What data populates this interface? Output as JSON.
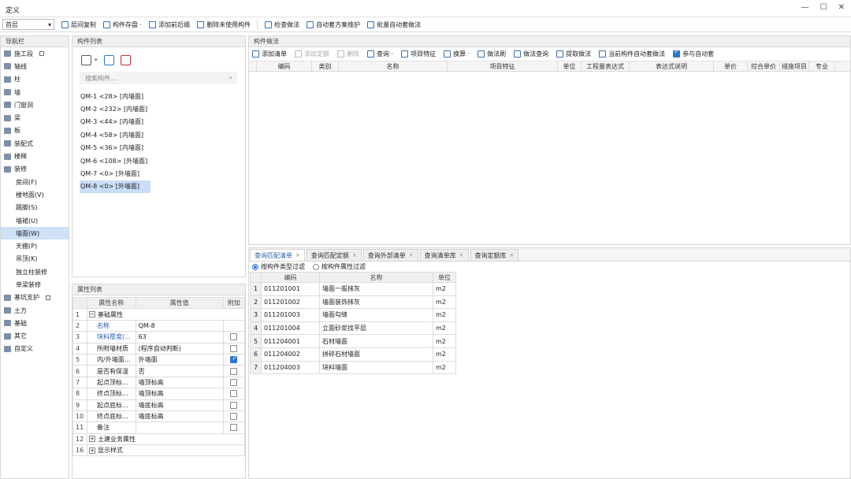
{
  "window": {
    "title": "定义",
    "controls": [
      "—",
      "☐",
      "✕"
    ]
  },
  "toolbar": {
    "floor": "首层",
    "buttons": [
      "层间复制",
      "构件存盘 ·",
      "添加前后缀",
      "删除未使用构件",
      "检查做法",
      "自动套方案维护",
      "批量自动套做法"
    ]
  },
  "nav": {
    "title": "导航栏",
    "items": [
      {
        "label": "施工段",
        "lock": true,
        "sub": false,
        "active": false
      },
      {
        "label": "轴线",
        "sub": false,
        "active": false
      },
      {
        "label": "柱",
        "sub": false,
        "active": false
      },
      {
        "label": "墙",
        "sub": false,
        "active": false
      },
      {
        "label": "门窗洞",
        "sub": false,
        "active": false
      },
      {
        "label": "梁",
        "sub": false,
        "active": false
      },
      {
        "label": "板",
        "sub": false,
        "active": false
      },
      {
        "label": "装配式",
        "sub": false,
        "active": false
      },
      {
        "label": "楼梯",
        "sub": false,
        "active": false
      },
      {
        "label": "装修",
        "sub": false,
        "active": false
      },
      {
        "label": "房间(F)",
        "sub": true,
        "active": false
      },
      {
        "label": "楼地面(V)",
        "sub": true,
        "active": false
      },
      {
        "label": "踢脚(S)",
        "sub": true,
        "active": false
      },
      {
        "label": "墙裙(U)",
        "sub": true,
        "active": false
      },
      {
        "label": "墙面(W)",
        "sub": true,
        "active": true
      },
      {
        "label": "天棚(P)",
        "sub": true,
        "active": false
      },
      {
        "label": "吊顶(K)",
        "sub": true,
        "active": false
      },
      {
        "label": "独立柱装修",
        "sub": true,
        "active": false
      },
      {
        "label": "单梁装修",
        "sub": true,
        "active": false
      },
      {
        "label": "基坑支护",
        "lock": true,
        "sub": false,
        "active": false
      },
      {
        "label": "土方",
        "sub": false,
        "active": false
      },
      {
        "label": "基础",
        "sub": false,
        "active": false
      },
      {
        "label": "其它",
        "sub": false,
        "active": false
      },
      {
        "label": "自定义",
        "sub": false,
        "active": false
      }
    ]
  },
  "components": {
    "title": "构件列表",
    "search_placeholder": "搜索构件...",
    "items": [
      {
        "label": "QM-1 <28> [内墙面]",
        "selected": false
      },
      {
        "label": "QM-2 <232> [内墙面]",
        "selected": false
      },
      {
        "label": "QM-3 <44> [内墙面]",
        "selected": false
      },
      {
        "label": "QM-4 <58> [内墙面]",
        "selected": false
      },
      {
        "label": "QM-5 <36> [内墙面]",
        "selected": false
      },
      {
        "label": "QM-6 <108> [外墙面]",
        "selected": false
      },
      {
        "label": "QM-7 <0> [外墙面]",
        "selected": false
      },
      {
        "label": "QM-8 <0> [外墙面]",
        "selected": true
      }
    ]
  },
  "properties": {
    "title": "属性列表",
    "headers": [
      "",
      "属性名称",
      "属性值",
      "附加"
    ],
    "rows": [
      {
        "no": "1",
        "name": "基础属性",
        "value": "",
        "check": null,
        "group": "minus",
        "blue": false
      },
      {
        "no": "2",
        "name": "名称",
        "value": "QM-8",
        "check": null,
        "group": "",
        "blue": true
      },
      {
        "no": "3",
        "name": "块料厚度(...",
        "value": "63",
        "check": false,
        "group": "",
        "blue": true
      },
      {
        "no": "4",
        "name": "所附墙材质",
        "value": "(程序自动判断)",
        "check": false,
        "group": "",
        "blue": false
      },
      {
        "no": "5",
        "name": "内/外墙面...",
        "value": "外墙面",
        "check": true,
        "group": "",
        "blue": false
      },
      {
        "no": "6",
        "name": "是否有保温",
        "value": "否",
        "check": false,
        "group": "",
        "blue": false
      },
      {
        "no": "7",
        "name": "起点顶标...",
        "value": "墙顶标高",
        "check": false,
        "group": "",
        "blue": false
      },
      {
        "no": "8",
        "name": "终点顶标...",
        "value": "墙顶标高",
        "check": false,
        "group": "",
        "blue": false
      },
      {
        "no": "9",
        "name": "起点底标...",
        "value": "墙底标高",
        "check": false,
        "group": "",
        "blue": false
      },
      {
        "no": "10",
        "name": "终点底标...",
        "value": "墙底标高",
        "check": false,
        "group": "",
        "blue": false
      },
      {
        "no": "11",
        "name": "备注",
        "value": "",
        "check": false,
        "group": "",
        "blue": false
      },
      {
        "no": "12",
        "name": "土建业务属性",
        "value": "",
        "check": null,
        "group": "plus",
        "blue": false
      },
      {
        "no": "16",
        "name": "显示样式",
        "value": "",
        "check": null,
        "group": "plus",
        "blue": false
      }
    ]
  },
  "method": {
    "title": "构件做法",
    "tools": [
      {
        "label": "添加清单",
        "disabled": false
      },
      {
        "label": "添加定额",
        "disabled": true
      },
      {
        "label": "删除",
        "disabled": true
      },
      {
        "label": "查询 ·",
        "disabled": false
      },
      {
        "label": "项目特征",
        "disabled": false
      },
      {
        "label": "换算 ·",
        "disabled": false
      },
      {
        "label": "做法刷",
        "disabled": false
      },
      {
        "label": "做法查询",
        "disabled": false
      },
      {
        "label": "提取做法",
        "disabled": false
      },
      {
        "label": "当前构件自动套做法",
        "disabled": false
      }
    ],
    "auto_label": "参与自动套",
    "columns": [
      "编码",
      "类别",
      "名称",
      "项目特征",
      "单位",
      "工程量表达式",
      "表达式说明",
      "单价",
      "综合单价",
      "措施项目",
      "专业"
    ]
  },
  "query": {
    "tabs": [
      "查询匹配清单",
      "查询匹配定额",
      "查询外部清单",
      "查询清单库",
      "查询定额库"
    ],
    "active_tab": 0,
    "filters": [
      {
        "label": "按构件类型过滤",
        "selected": true
      },
      {
        "label": "按构件属性过滤",
        "selected": false
      }
    ],
    "headers": [
      "",
      "编码",
      "名称",
      "单位"
    ],
    "rows": [
      {
        "no": "1",
        "code": "011201001",
        "name": "墙面一般抹灰",
        "unit": "m2"
      },
      {
        "no": "2",
        "code": "011201002",
        "name": "墙面装饰抹灰",
        "unit": "m2"
      },
      {
        "no": "3",
        "code": "011201003",
        "name": "墙面勾缝",
        "unit": "m2"
      },
      {
        "no": "4",
        "code": "011201004",
        "name": "立面砂浆找平层",
        "unit": "m2"
      },
      {
        "no": "5",
        "code": "011204001",
        "name": "石材墙面",
        "unit": "m2"
      },
      {
        "no": "6",
        "code": "011204002",
        "name": "拼碎石材墙面",
        "unit": "m2"
      },
      {
        "no": "7",
        "code": "011204003",
        "name": "块料墙面",
        "unit": "m2"
      }
    ]
  }
}
